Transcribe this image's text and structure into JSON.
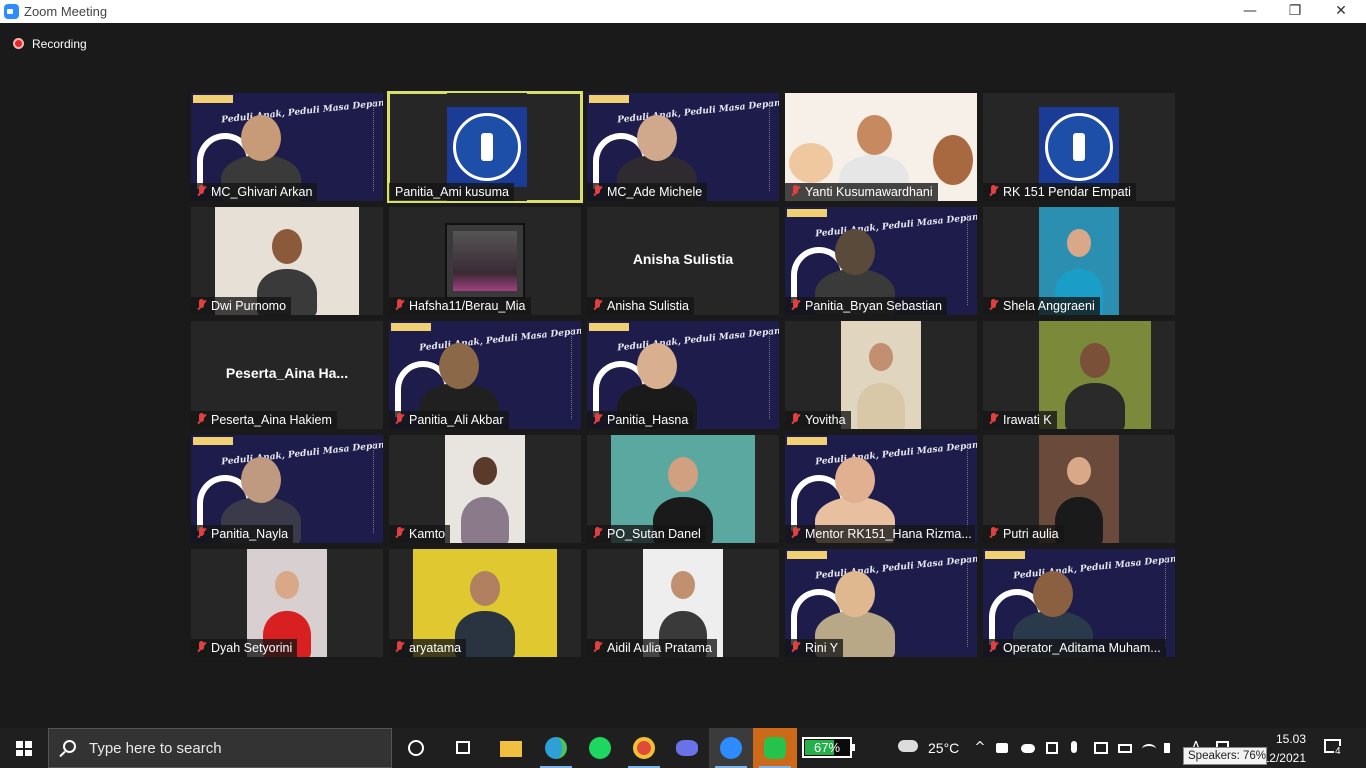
{
  "window": {
    "title": "Zoom Meeting",
    "minimize_glyph": "—",
    "restore_glyph": "❐",
    "close_glyph": "✕"
  },
  "recording": {
    "label": "Recording"
  },
  "participants": [
    {
      "name": "MC_Ghivari Arkan",
      "muted": true
    },
    {
      "name": "Panitia_Ami kusuma",
      "muted": false,
      "active_speaker": true
    },
    {
      "name": "MC_Ade Michele",
      "muted": true
    },
    {
      "name": "Yanti Kusumawardhani",
      "muted": true
    },
    {
      "name": "RK 151 Pendar Empati",
      "muted": true
    },
    {
      "name": "Dwi Purnomo",
      "muted": true
    },
    {
      "name": "Hafsha11/Berau_Mia",
      "muted": true
    },
    {
      "name": "Anisha Sulistia",
      "muted": true,
      "video_off": true,
      "display_name": "Anisha Sulistia"
    },
    {
      "name": "Panitia_Bryan Sebastian",
      "muted": true
    },
    {
      "name": "Shela Anggraeni",
      "muted": true
    },
    {
      "name": "Peserta_Aina Hakiem",
      "muted": true,
      "video_off": true,
      "display_name": "Peserta_Aina  Ha..."
    },
    {
      "name": "Panitia_Ali Akbar",
      "muted": true
    },
    {
      "name": "Panitia_Hasna",
      "muted": true
    },
    {
      "name": "Yovitha",
      "muted": true
    },
    {
      "name": "Irawati K",
      "muted": true
    },
    {
      "name": "Panitia_Nayla",
      "muted": true
    },
    {
      "name": "Kamto",
      "muted": true
    },
    {
      "name": "PO_Sutan Danel",
      "muted": true
    },
    {
      "name": "Mentor RK151_Hana Rizma...",
      "muted": true
    },
    {
      "name": "Putri aulia",
      "muted": true
    },
    {
      "name": "Dyah Setyorini",
      "muted": true
    },
    {
      "name": "aryatama",
      "muted": true
    },
    {
      "name": "Aidil Aulia Pratama",
      "muted": true
    },
    {
      "name": "Rini Y",
      "muted": true
    },
    {
      "name": "Operator_Aditama Muham...",
      "muted": true
    }
  ],
  "virtual_background": {
    "banner_text": "Peduli Anak, Peduli Masa Depan"
  },
  "taskbar": {
    "search_placeholder": "Type here to search",
    "battery_percent": 67,
    "battery_label": "67%",
    "weather_temp": "25°C",
    "clock_time": "15.03",
    "clock_date": "12/2021",
    "notification_count": "4",
    "speakers_tooltip": "Speakers: 76%",
    "tray_chevron": "^",
    "tray_lang": "A"
  },
  "colors": {
    "accent_active_speaker": "#d8e06a",
    "mute_red": "#e04040",
    "zoom_blue": "#2d8cff",
    "battery_green": "#26b04a"
  }
}
